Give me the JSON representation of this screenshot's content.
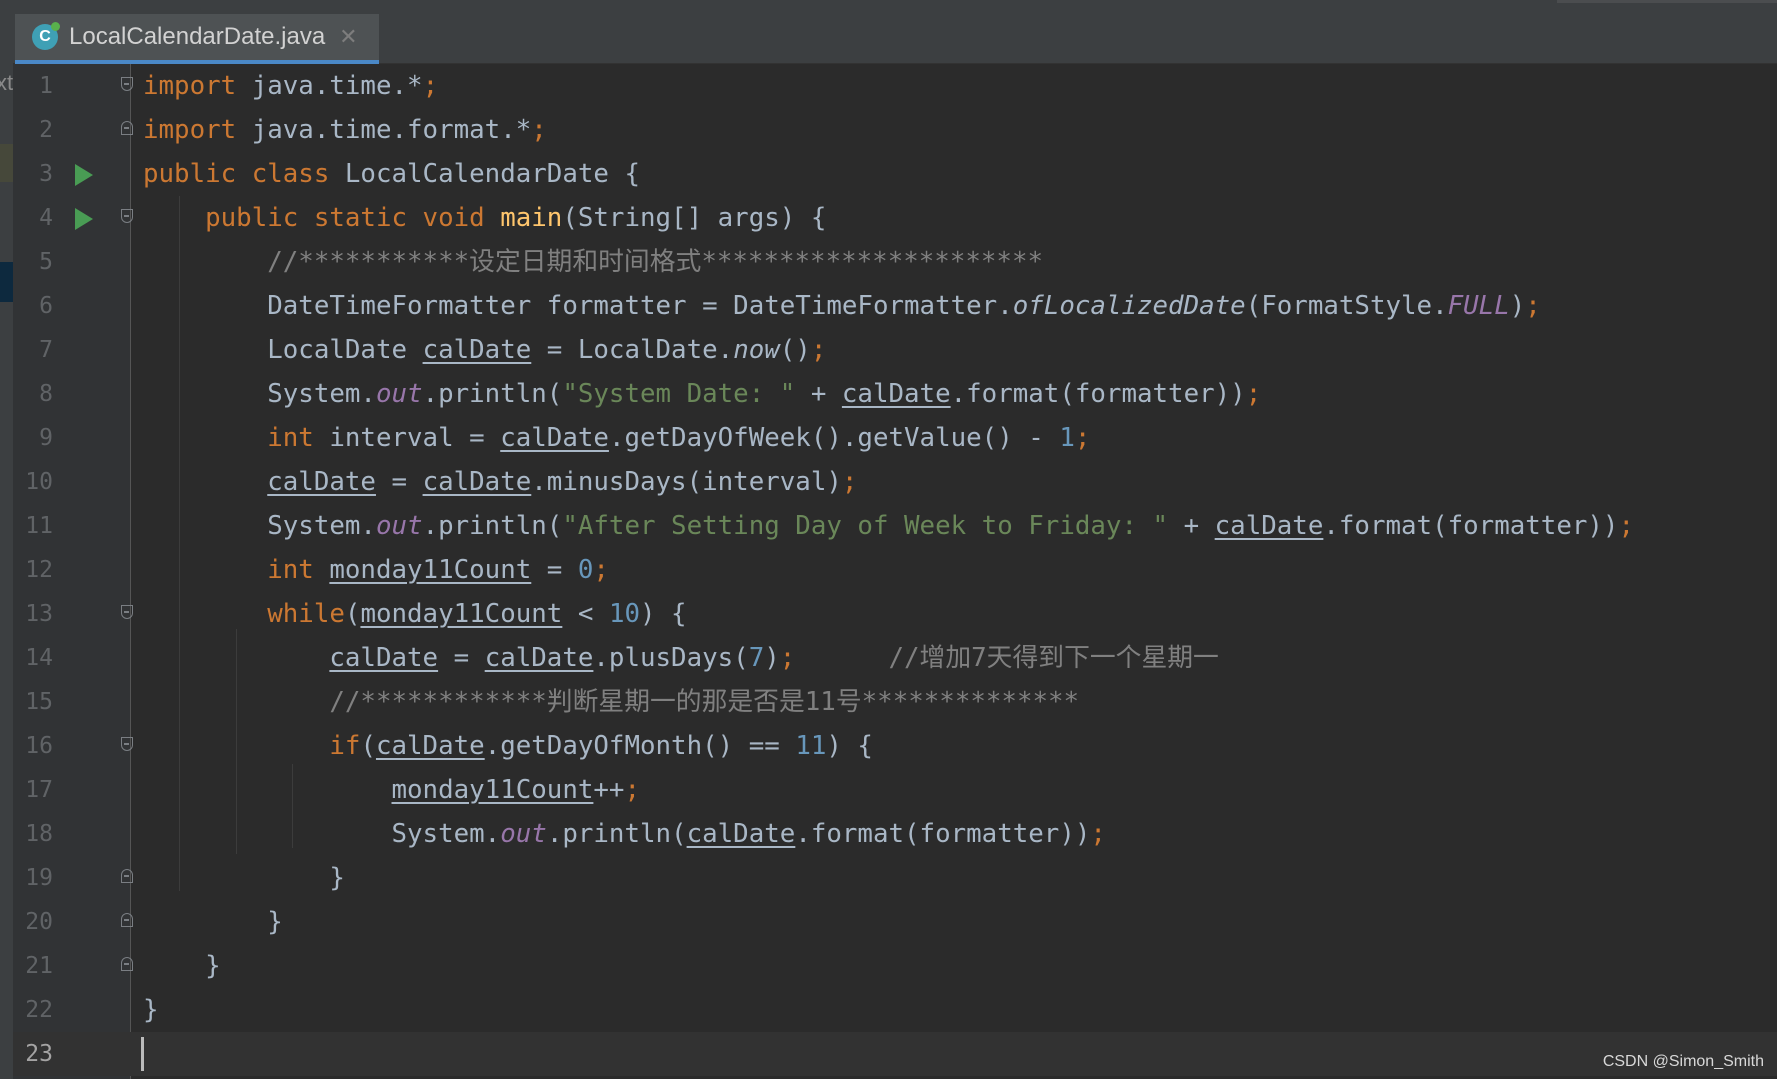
{
  "editor_tab": {
    "filename": "LocalCalendarDate.java",
    "close_glyph": "✕",
    "file_icon": "java-class-icon",
    "file_icon_letter": "C"
  },
  "left_panel_fragment": "xt",
  "watermark": "CSDN @Simon_Smith",
  "current_line": 23,
  "lines": [
    {
      "n": "1",
      "fold": "open",
      "tokens": [
        [
          "keyword",
          "import"
        ],
        [
          "plain",
          " java.time.*"
        ],
        [
          "semi",
          ";"
        ]
      ]
    },
    {
      "n": "2",
      "fold": "close",
      "tokens": [
        [
          "keyword",
          "import"
        ],
        [
          "plain",
          " java.time.format.*"
        ],
        [
          "semi",
          ";"
        ]
      ]
    },
    {
      "n": "3",
      "run": true,
      "tokens": [
        [
          "keyword",
          "public class"
        ],
        [
          "plain",
          " LocalCalendarDate {"
        ]
      ]
    },
    {
      "n": "4",
      "run": true,
      "fold": "open",
      "tokens": [
        [
          "plain",
          "    "
        ],
        [
          "keyword",
          "public static void"
        ],
        [
          "plain",
          " "
        ],
        [
          "method",
          "main"
        ],
        [
          "plain",
          "(String[] args) {"
        ]
      ]
    },
    {
      "n": "5",
      "tokens": [
        [
          "plain",
          "        "
        ],
        [
          "comment",
          "//***********设定日期和时间格式**********************"
        ]
      ]
    },
    {
      "n": "6",
      "tokens": [
        [
          "plain",
          "        DateTimeFormatter formatter = DateTimeFormatter."
        ],
        [
          "italic",
          "ofLocalizedDate"
        ],
        [
          "plain",
          "(FormatStyle."
        ],
        [
          "field",
          "FULL"
        ],
        [
          "plain",
          ")"
        ],
        [
          "semi",
          ";"
        ]
      ]
    },
    {
      "n": "7",
      "tokens": [
        [
          "plain",
          "        LocalDate "
        ],
        [
          "underline",
          "calDate"
        ],
        [
          "plain",
          " = LocalDate."
        ],
        [
          "italic",
          "now"
        ],
        [
          "plain",
          "()"
        ],
        [
          "semi",
          ";"
        ]
      ]
    },
    {
      "n": "8",
      "tokens": [
        [
          "plain",
          "        System."
        ],
        [
          "field",
          "out"
        ],
        [
          "plain",
          ".println("
        ],
        [
          "string",
          "\"System Date: \""
        ],
        [
          "plain",
          " + "
        ],
        [
          "underline",
          "calDate"
        ],
        [
          "plain",
          ".format(formatter))"
        ],
        [
          "semi",
          ";"
        ]
      ]
    },
    {
      "n": "9",
      "tokens": [
        [
          "plain",
          "        "
        ],
        [
          "keyword",
          "int"
        ],
        [
          "plain",
          " interval = "
        ],
        [
          "underline",
          "calDate"
        ],
        [
          "plain",
          ".getDayOfWeek().getValue() - "
        ],
        [
          "number",
          "1"
        ],
        [
          "semi",
          ";"
        ]
      ]
    },
    {
      "n": "10",
      "tokens": [
        [
          "plain",
          "        "
        ],
        [
          "underline",
          "calDate"
        ],
        [
          "plain",
          " = "
        ],
        [
          "underline",
          "calDate"
        ],
        [
          "plain",
          ".minusDays(interval)"
        ],
        [
          "semi",
          ";"
        ]
      ]
    },
    {
      "n": "11",
      "tokens": [
        [
          "plain",
          "        System."
        ],
        [
          "field",
          "out"
        ],
        [
          "plain",
          ".println("
        ],
        [
          "string",
          "\"After Setting Day of Week to Friday: \""
        ],
        [
          "plain",
          " + "
        ],
        [
          "underline",
          "calDate"
        ],
        [
          "plain",
          ".format(formatter))"
        ],
        [
          "semi",
          ";"
        ]
      ]
    },
    {
      "n": "12",
      "tokens": [
        [
          "plain",
          "        "
        ],
        [
          "keyword",
          "int"
        ],
        [
          "plain",
          " "
        ],
        [
          "underline",
          "monday11Count"
        ],
        [
          "plain",
          " = "
        ],
        [
          "number",
          "0"
        ],
        [
          "semi",
          ";"
        ]
      ]
    },
    {
      "n": "13",
      "fold": "open",
      "tokens": [
        [
          "plain",
          "        "
        ],
        [
          "keyword",
          "while"
        ],
        [
          "plain",
          "("
        ],
        [
          "underline",
          "monday11Count"
        ],
        [
          "plain",
          " < "
        ],
        [
          "number",
          "10"
        ],
        [
          "plain",
          ") {"
        ]
      ]
    },
    {
      "n": "14",
      "tokens": [
        [
          "plain",
          "            "
        ],
        [
          "underline",
          "calDate"
        ],
        [
          "plain",
          " = "
        ],
        [
          "underline",
          "calDate"
        ],
        [
          "plain",
          ".plusDays("
        ],
        [
          "number",
          "7"
        ],
        [
          "plain",
          ")"
        ],
        [
          "semi",
          ";"
        ],
        [
          "plain",
          "      "
        ],
        [
          "comment",
          "//增加7天得到下一个星期一"
        ]
      ]
    },
    {
      "n": "15",
      "tokens": [
        [
          "plain",
          "            "
        ],
        [
          "comment",
          "//************判断星期一的那是否是11号**************"
        ]
      ]
    },
    {
      "n": "16",
      "fold": "open",
      "tokens": [
        [
          "plain",
          "            "
        ],
        [
          "keyword",
          "if"
        ],
        [
          "plain",
          "("
        ],
        [
          "underline",
          "calDate"
        ],
        [
          "plain",
          ".getDayOfMonth() == "
        ],
        [
          "number",
          "11"
        ],
        [
          "plain",
          ") {"
        ]
      ]
    },
    {
      "n": "17",
      "tokens": [
        [
          "plain",
          "                "
        ],
        [
          "underline",
          "monday11Count"
        ],
        [
          "plain",
          "++"
        ],
        [
          "semi",
          ";"
        ]
      ]
    },
    {
      "n": "18",
      "tokens": [
        [
          "plain",
          "                System."
        ],
        [
          "field",
          "out"
        ],
        [
          "plain",
          ".println("
        ],
        [
          "underline",
          "calDate"
        ],
        [
          "plain",
          ".format(formatter))"
        ],
        [
          "semi",
          ";"
        ]
      ]
    },
    {
      "n": "19",
      "fold": "close",
      "tokens": [
        [
          "plain",
          "            }"
        ]
      ]
    },
    {
      "n": "20",
      "fold": "close",
      "tokens": [
        [
          "plain",
          "        }"
        ]
      ]
    },
    {
      "n": "21",
      "fold": "close",
      "tokens": [
        [
          "plain",
          "    }"
        ]
      ]
    },
    {
      "n": "22",
      "tokens": [
        [
          "plain",
          "}"
        ]
      ]
    },
    {
      "n": "23",
      "tokens": []
    }
  ]
}
